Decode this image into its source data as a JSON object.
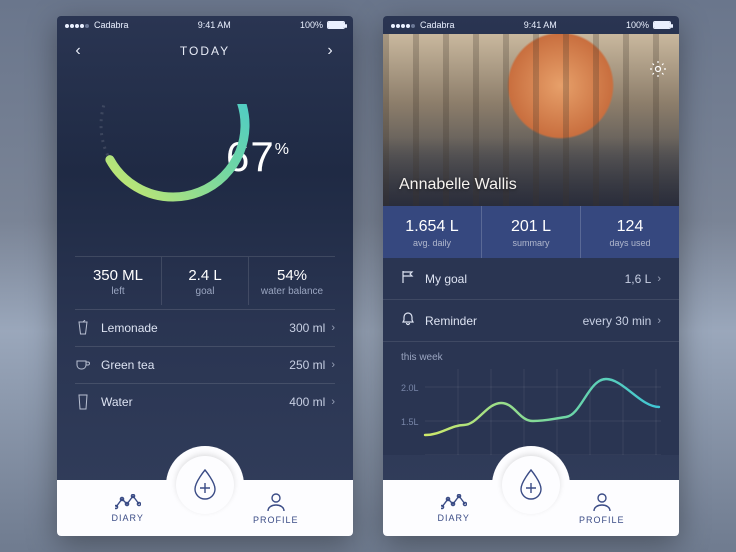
{
  "status": {
    "carrier": "Cadabra",
    "time": "9:41 AM",
    "battery": "100%"
  },
  "today": {
    "title": "TODAY",
    "percent": "67",
    "percent_symbol": "%",
    "summary": [
      {
        "value": "350 ML",
        "label": "left"
      },
      {
        "value": "2.4 L",
        "label": "goal"
      },
      {
        "value": "54%",
        "label": "water balance"
      }
    ],
    "drinks": [
      {
        "icon": "lemonade-icon",
        "name": "Lemonade",
        "amount": "300 ml"
      },
      {
        "icon": "tea-icon",
        "name": "Green tea",
        "amount": "250 ml"
      },
      {
        "icon": "water-icon",
        "name": "Water",
        "amount": "400 ml"
      }
    ]
  },
  "profile": {
    "name": "Annabelle Wallis",
    "stats": [
      {
        "value": "1.654 L",
        "label": "avg. daily"
      },
      {
        "value": "201 L",
        "label": "summary"
      },
      {
        "value": "124",
        "label": "days used"
      }
    ],
    "goal": {
      "label": "My goal",
      "value": "1,6 L"
    },
    "reminder": {
      "label": "Reminder",
      "value": "every 30 min"
    },
    "chart_title": "this week"
  },
  "tabs": {
    "diary": "DIARY",
    "profile": "PROFILE"
  },
  "chart_data": {
    "type": "line",
    "title": "this week",
    "ylabel": "L",
    "ylim": [
      1.0,
      2.2
    ],
    "y_ticks": [
      "2.0L",
      "1.5L"
    ],
    "x": [
      0,
      1,
      2,
      3,
      4,
      5,
      6
    ],
    "values": [
      1.3,
      1.45,
      1.75,
      1.5,
      1.55,
      2.1,
      1.7
    ]
  }
}
